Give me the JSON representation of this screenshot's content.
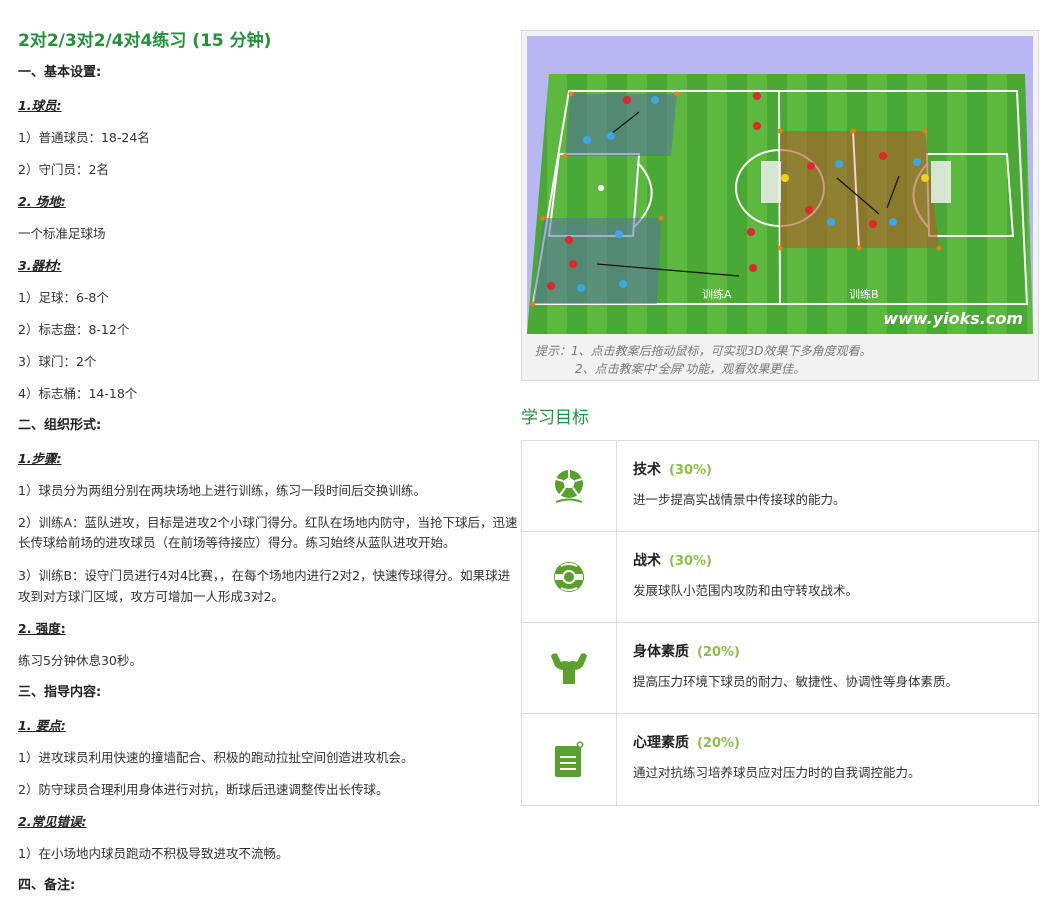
{
  "title": "2对2/3对2/4对4练习 (15 分钟)",
  "left": {
    "s1": "一、基本设置:",
    "players_h": "1.球员:",
    "players_1": "1）普通球员：18-24名",
    "players_2": "2）守门员：2名",
    "field_h": "2. 场地:",
    "field_1": "一个标准足球场",
    "equip_h": "3.器材:",
    "equip_1": "1）足球：6-8个",
    "equip_2": "2）标志盘：8-12个",
    "equip_3": "3）球门：2个",
    "equip_4": "4）标志桶：14-18个",
    "s2": "二、组织形式:",
    "steps_h": "1.步骤:",
    "steps_1": "1）球员分为两组分别在两块场地上进行训练，练习一段时间后交换训练。",
    "steps_2": "2）训练A：蓝队进攻，目标是进攻2个小球门得分。红队在场地内防守，当抢下球后，迅速长传球给前场的进攻球员（在前场等待接应）得分。练习始终从蓝队进攻开始。",
    "steps_3": "3）训练B：设守门员进行4对4比赛，，在每个场地内进行2对2，快速传球得分。如果球进攻到对方球门区域，攻方可增加一人形成3对2。",
    "intensity_h": "2. 强度:",
    "intensity_1": "练习5分钟休息30秒。",
    "s3": "三、指导内容:",
    "points_h": "1. 要点:",
    "points_1": "1）进攻球员利用快速的撞墙配合、积极的跑动拉扯空间创造进攻机会。",
    "points_2": "2）防守球员合理利用身体进行对抗，断球后迅速调整传出长传球。",
    "errors_h": "2.常见错误:",
    "errors_1": "1）在小场地内球员跑动不积极导致进攻不流畅。",
    "s4": "四、备注:"
  },
  "diagram": {
    "label_a": "训练A",
    "label_b": "训练B",
    "watermark": "www.yioks.com",
    "hint_1": "提示：1、点击教案后拖动鼠标，可实现3D效果下多角度观看。",
    "hint_2": "2、点击教案中'全屏'功能，观看效果更佳。"
  },
  "goals_title": "学习目标",
  "goals": [
    {
      "name": "技术",
      "pct": "(30%)",
      "desc": "进一步提高实战情景中传接球的能力。",
      "icon": "soccer-ball-icon"
    },
    {
      "name": "战术",
      "pct": "(30%)",
      "desc": "发展球队小范围内攻防和由守转攻战术。",
      "icon": "tactics-ball-icon"
    },
    {
      "name": "身体素质",
      "pct": "(20%)",
      "desc": "提高压力环境下球员的耐力、敏捷性、协调性等身体素质。",
      "icon": "muscle-icon"
    },
    {
      "name": "心理素质",
      "pct": "(20%)",
      "desc": "通过对抗练习培养球员应对压力时的自我调控能力。",
      "icon": "clipboard-heart-icon"
    }
  ],
  "colors": {
    "accent_green": "#22913a",
    "icon_green": "#5aa02c",
    "pct_green": "#8bbf4a"
  }
}
